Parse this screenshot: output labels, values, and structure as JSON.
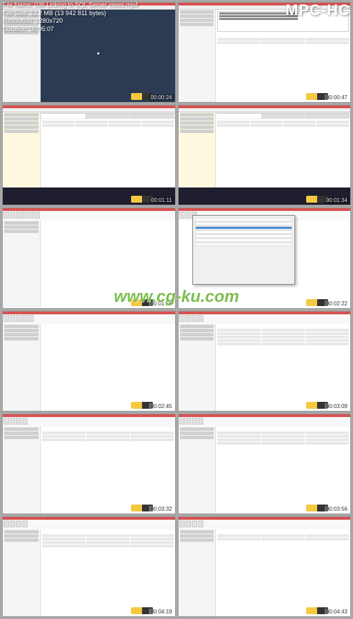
{
  "file_info": {
    "name_label": "File Name:",
    "name_value": "036 Linking to SQL Server views.mp4",
    "size_label": "File Size:",
    "size_value": "13,2 MB (13 942 811 bytes)",
    "resolution_label": "Resolution:",
    "resolution_value": "1280x720",
    "duration_label": "Duration:",
    "duration_value": "00:05:07"
  },
  "app_name": "MPC-HC",
  "watermark": "www.cg-ku.com",
  "thumbnails": [
    {
      "timestamp": "00:00:24",
      "type": "sql-dark",
      "lynda": "lynda"
    },
    {
      "timestamp": "00:00:47",
      "type": "sql-query",
      "lynda": "lynda"
    },
    {
      "timestamp": "00:01:11",
      "type": "sql-tables",
      "lynda": "lynda"
    },
    {
      "timestamp": "00:01:34",
      "type": "sql-tables",
      "lynda": "lynda"
    },
    {
      "timestamp": "00:01:58",
      "type": "access-empty",
      "lynda": "lynda"
    },
    {
      "timestamp": "00:02:22",
      "type": "access-dialog",
      "lynda": "lynda"
    },
    {
      "timestamp": "00:02:45",
      "type": "access-empty",
      "lynda": "lynda"
    },
    {
      "timestamp": "00:03:09",
      "type": "access-data",
      "lynda": "lynda"
    },
    {
      "timestamp": "00:03:32",
      "type": "access-data",
      "lynda": "lynda"
    },
    {
      "timestamp": "00:03:56",
      "type": "access-data",
      "lynda": "lynda"
    },
    {
      "timestamp": "00:04:19",
      "type": "access-data",
      "lynda": "lynda"
    },
    {
      "timestamp": "00:04:43",
      "type": "access-data",
      "lynda": "lynda"
    }
  ]
}
